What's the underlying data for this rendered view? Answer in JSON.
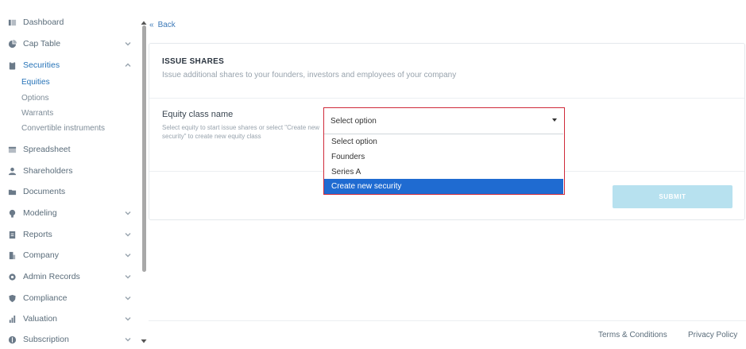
{
  "sidebar": {
    "items": [
      {
        "label": "Dashboard",
        "icon": "dashboard-icon",
        "has_chevron": false
      },
      {
        "label": "Cap Table",
        "icon": "pie-chart-icon",
        "has_chevron": true
      },
      {
        "label": "Securities",
        "icon": "clipboard-icon",
        "has_chevron": true,
        "expanded": true
      },
      {
        "label": "Spreadsheet",
        "icon": "spreadsheet-icon",
        "has_chevron": false
      },
      {
        "label": "Shareholders",
        "icon": "user-icon",
        "has_chevron": false
      },
      {
        "label": "Documents",
        "icon": "folder-icon",
        "has_chevron": false
      },
      {
        "label": "Modeling",
        "icon": "lightbulb-icon",
        "has_chevron": true
      },
      {
        "label": "Reports",
        "icon": "report-icon",
        "has_chevron": true
      },
      {
        "label": "Company",
        "icon": "building-icon",
        "has_chevron": true
      },
      {
        "label": "Admin Records",
        "icon": "gear-icon",
        "has_chevron": true
      },
      {
        "label": "Compliance",
        "icon": "shield-icon",
        "has_chevron": true
      },
      {
        "label": "Valuation",
        "icon": "chart-icon",
        "has_chevron": true
      },
      {
        "label": "Subscription",
        "icon": "dollar-icon",
        "has_chevron": true
      }
    ],
    "securities_sub": [
      "Equities",
      "Options",
      "Warrants",
      "Convertible instruments"
    ]
  },
  "main": {
    "back_label": "Back",
    "card": {
      "title": "ISSUE SHARES",
      "subtitle": "Issue additional shares to your founders, investors and employees of your company",
      "field_label": "Equity class name",
      "field_help": "Select equity to start issue shares or select \"Create new security\" to create new equity class",
      "select": {
        "value": "Select option",
        "options": [
          "Select option",
          "Founders",
          "Series A",
          "Create new security"
        ],
        "highlighted": "Create new security"
      },
      "submit_label": "SUBMIT"
    }
  },
  "footer": {
    "terms": "Terms & Conditions",
    "privacy": "Privacy Policy"
  },
  "colors": {
    "accent": "#2673b8",
    "highlight": "#1f6bd1",
    "focus_border": "#cf2a3a",
    "submit_disabled": "#b7e1ef"
  }
}
